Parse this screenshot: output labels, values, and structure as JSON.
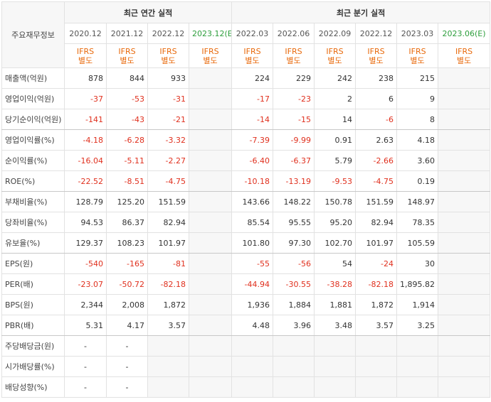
{
  "table": {
    "corner_label": "주요재무정보",
    "group_annual": "최근 연간 실적",
    "group_quarter": "최근 분기 실적",
    "periods": [
      {
        "date": "2020.12",
        "ifrs_top": "IFRS",
        "ifrs_bottom": "별도",
        "estimate": false
      },
      {
        "date": "2021.12",
        "ifrs_top": "IFRS",
        "ifrs_bottom": "별도",
        "estimate": false
      },
      {
        "date": "2022.12",
        "ifrs_top": "IFRS",
        "ifrs_bottom": "별도",
        "estimate": false
      },
      {
        "date": "2023.12",
        "date_suffix": "(E)",
        "ifrs_top": "IFRS",
        "ifrs_bottom": "별도",
        "estimate": true
      },
      {
        "date": "2022.03",
        "ifrs_top": "IFRS",
        "ifrs_bottom": "별도",
        "estimate": false
      },
      {
        "date": "2022.06",
        "ifrs_top": "IFRS",
        "ifrs_bottom": "별도",
        "estimate": false
      },
      {
        "date": "2022.09",
        "ifrs_top": "IFRS",
        "ifrs_bottom": "별도",
        "estimate": false
      },
      {
        "date": "2022.12",
        "ifrs_top": "IFRS",
        "ifrs_bottom": "별도",
        "estimate": false
      },
      {
        "date": "2023.03",
        "ifrs_top": "IFRS",
        "ifrs_bottom": "별도",
        "estimate": false
      },
      {
        "date": "2023.06",
        "date_suffix": "(E)",
        "ifrs_top": "IFRS",
        "ifrs_bottom": "별도",
        "estimate": true
      }
    ],
    "rows": [
      {
        "label": "매출액(억원)",
        "values": [
          "878",
          "844",
          "933",
          "",
          "224",
          "229",
          "242",
          "238",
          "215",
          ""
        ]
      },
      {
        "label": "영업이익(억원)",
        "values": [
          "-37",
          "-53",
          "-31",
          "",
          "-17",
          "-23",
          "2",
          "6",
          "9",
          ""
        ]
      },
      {
        "label": "당기순이익(억원)",
        "values": [
          "-141",
          "-43",
          "-21",
          "",
          "-14",
          "-15",
          "14",
          "-6",
          "8",
          ""
        ]
      },
      {
        "label": "영업이익률(%)",
        "values": [
          "-4.18",
          "-6.28",
          "-3.32",
          "",
          "-7.39",
          "-9.99",
          "0.91",
          "2.63",
          "4.18",
          ""
        ]
      },
      {
        "label": "순이익률(%)",
        "values": [
          "-16.04",
          "-5.11",
          "-2.27",
          "",
          "-6.40",
          "-6.37",
          "5.79",
          "-2.66",
          "3.60",
          ""
        ]
      },
      {
        "label": "ROE(%)",
        "values": [
          "-22.52",
          "-8.51",
          "-4.75",
          "",
          "-10.18",
          "-13.19",
          "-9.53",
          "-4.75",
          "0.19",
          ""
        ]
      },
      {
        "label": "부채비율(%)",
        "values": [
          "128.79",
          "125.20",
          "151.59",
          "",
          "143.66",
          "148.22",
          "150.78",
          "151.59",
          "148.97",
          ""
        ]
      },
      {
        "label": "당좌비율(%)",
        "values": [
          "94.53",
          "86.37",
          "82.94",
          "",
          "85.54",
          "95.55",
          "95.20",
          "82.94",
          "78.35",
          ""
        ]
      },
      {
        "label": "유보율(%)",
        "values": [
          "129.37",
          "108.23",
          "101.97",
          "",
          "101.80",
          "97.30",
          "102.70",
          "101.97",
          "105.59",
          ""
        ]
      },
      {
        "label": "EPS(원)",
        "values": [
          "-540",
          "-165",
          "-81",
          "",
          "-55",
          "-56",
          "54",
          "-24",
          "30",
          ""
        ]
      },
      {
        "label": "PER(배)",
        "values": [
          "-23.07",
          "-50.72",
          "-82.18",
          "",
          "-44.94",
          "-30.55",
          "-38.28",
          "-82.18",
          "1,895.82",
          ""
        ]
      },
      {
        "label": "BPS(원)",
        "values": [
          "2,344",
          "2,008",
          "1,872",
          "",
          "1,936",
          "1,884",
          "1,881",
          "1,872",
          "1,914",
          ""
        ]
      },
      {
        "label": "PBR(배)",
        "values": [
          "5.31",
          "4.17",
          "3.57",
          "",
          "4.48",
          "3.96",
          "3.48",
          "3.57",
          "3.25",
          ""
        ]
      },
      {
        "label": "주당배당금(원)",
        "values": [
          "-",
          "-",
          "",
          "",
          "",
          "",
          "",
          "",
          "",
          ""
        ]
      },
      {
        "label": "시가배당률(%)",
        "values": [
          "-",
          "-",
          "",
          "",
          "",
          "",
          "",
          "",
          "",
          ""
        ]
      },
      {
        "label": "배당성향(%)",
        "values": [
          "-",
          "-",
          "",
          "",
          "",
          "",
          "",
          "",
          "",
          ""
        ]
      }
    ],
    "colors": {
      "negative": "#e0301e",
      "ifrs": "#e8690b",
      "estimate": "#2d9e3c",
      "header_bg": "#f7f7f7"
    }
  }
}
